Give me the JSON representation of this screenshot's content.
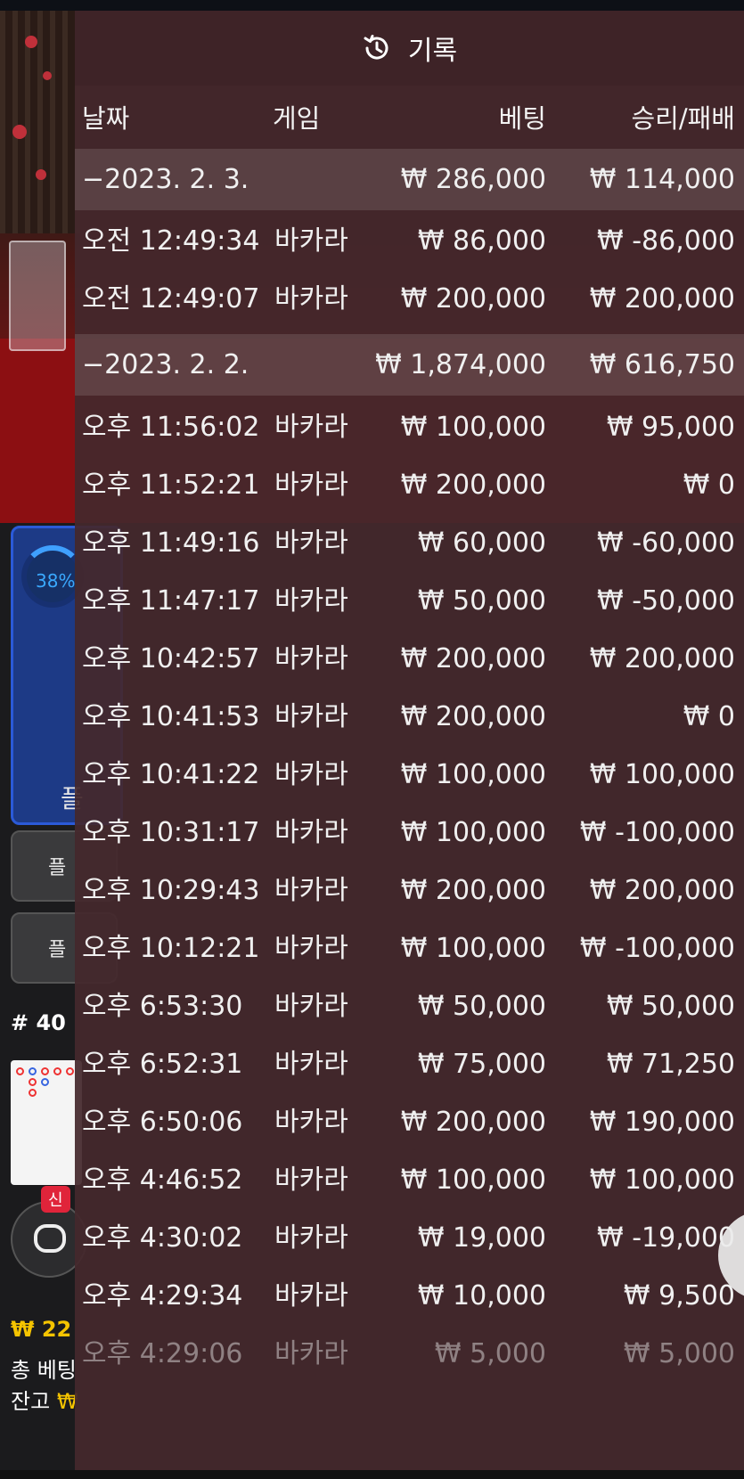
{
  "background": {
    "progress_percent_label": "38%",
    "progress_fraction": 0.38,
    "player_label": "플",
    "button1_label": "플",
    "button2_label": "플",
    "round_label": "# 40",
    "new_badge": "신",
    "balance_line": "₩ 22",
    "total_bet_label": "총 베팅",
    "balance_label": "잔고",
    "balance_value": "₩"
  },
  "history": {
    "title": "기록",
    "icon": "history-icon",
    "columns": [
      "날짜",
      "게임",
      "베팅",
      "승리/패배"
    ],
    "rows": [
      {
        "type": "date",
        "time": "−2023. 2. 3.",
        "game": "",
        "bet": "₩ 286,000",
        "result": "₩ 114,000"
      },
      {
        "type": "item",
        "time": "오전 12:49:34",
        "game": "바카라",
        "bet": "₩ 86,000",
        "result": "₩ -86,000"
      },
      {
        "type": "item",
        "time": "오전 12:49:07",
        "game": "바카라",
        "bet": "₩ 200,000",
        "result": "₩ 200,000"
      },
      {
        "type": "date",
        "time": "−2023. 2. 2.",
        "game": "",
        "bet": "₩ 1,874,000",
        "result": "₩ 616,750"
      },
      {
        "type": "item",
        "time": "오후 11:56:02",
        "game": "바카라",
        "bet": "₩ 100,000",
        "result": "₩ 95,000"
      },
      {
        "type": "item",
        "time": "오후 11:52:21",
        "game": "바카라",
        "bet": "₩ 200,000",
        "result": "₩ 0"
      },
      {
        "type": "item",
        "time": "오후 11:49:16",
        "game": "바카라",
        "bet": "₩ 60,000",
        "result": "₩ -60,000"
      },
      {
        "type": "item",
        "time": "오후 11:47:17",
        "game": "바카라",
        "bet": "₩ 50,000",
        "result": "₩ -50,000"
      },
      {
        "type": "item",
        "time": "오후 10:42:57",
        "game": "바카라",
        "bet": "₩ 200,000",
        "result": "₩ 200,000"
      },
      {
        "type": "item",
        "time": "오후 10:41:53",
        "game": "바카라",
        "bet": "₩ 200,000",
        "result": "₩ 0"
      },
      {
        "type": "item",
        "time": "오후 10:41:22",
        "game": "바카라",
        "bet": "₩ 100,000",
        "result": "₩ 100,000"
      },
      {
        "type": "item",
        "time": "오후 10:31:17",
        "game": "바카라",
        "bet": "₩ 100,000",
        "result": "₩ -100,000"
      },
      {
        "type": "item",
        "time": "오후 10:29:43",
        "game": "바카라",
        "bet": "₩ 200,000",
        "result": "₩ 200,000"
      },
      {
        "type": "item",
        "time": "오후 10:12:21",
        "game": "바카라",
        "bet": "₩ 100,000",
        "result": "₩ -100,000"
      },
      {
        "type": "item",
        "time": "오후 6:53:30",
        "game": "바카라",
        "bet": "₩ 50,000",
        "result": "₩ 50,000"
      },
      {
        "type": "item",
        "time": "오후 6:52:31",
        "game": "바카라",
        "bet": "₩ 75,000",
        "result": "₩ 71,250"
      },
      {
        "type": "item",
        "time": "오후 6:50:06",
        "game": "바카라",
        "bet": "₩ 200,000",
        "result": "₩ 190,000"
      },
      {
        "type": "item",
        "time": "오후 4:46:52",
        "game": "바카라",
        "bet": "₩ 100,000",
        "result": "₩ 100,000"
      },
      {
        "type": "item",
        "time": "오후 4:30:02",
        "game": "바카라",
        "bet": "₩ 19,000",
        "result": "₩ -19,000"
      },
      {
        "type": "item",
        "time": "오후 4:29:34",
        "game": "바카라",
        "bet": "₩ 10,000",
        "result": "₩ 9,500"
      },
      {
        "type": "item",
        "time": "오후 4:29:06",
        "game": "바카라",
        "bet": "₩ 5,000",
        "result": "₩ 5,000",
        "faded": true
      }
    ],
    "close_icon": "close-icon"
  }
}
